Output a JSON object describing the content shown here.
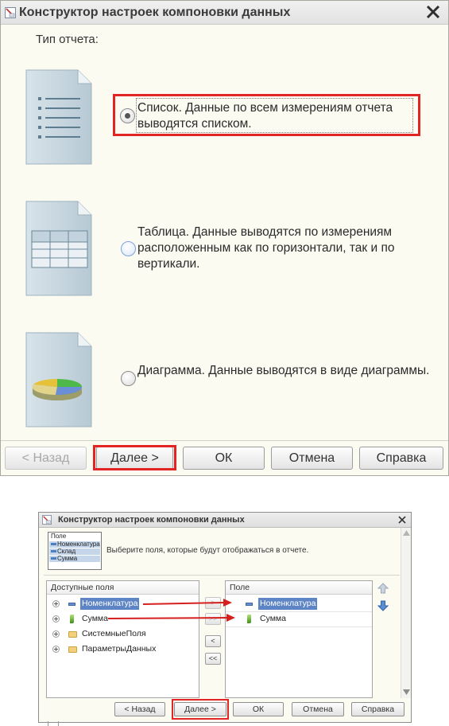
{
  "dialog1": {
    "title": "Конструктор настроек компоновки данных",
    "section_label": "Тип отчета:",
    "options": [
      {
        "label": "Список. Данные по всем измерениям отчета выводятся списком.",
        "selected": true
      },
      {
        "label": "Таблица. Данные выводятся по измерениям расположенным как по горизонтали, так и по вертикали.",
        "selected": false
      },
      {
        "label": "Диаграмма. Данные выводятся в виде диаграммы.",
        "selected": false
      }
    ],
    "buttons": {
      "back": "< Назад",
      "next": "Далее >",
      "ok": "ОК",
      "cancel": "Отмена",
      "help": "Справка"
    }
  },
  "dialog2": {
    "title": "Конструктор настроек компоновки данных",
    "thumbnail": {
      "header": "Поле",
      "rows": [
        "Номенклатура",
        "Склад",
        "Сумма"
      ]
    },
    "hint": "Выберите поля, которые будут отображаться в отчете.",
    "available": {
      "header": "Доступные поля",
      "items": [
        "Номенклатура",
        "Сумма",
        "СистемныеПоля",
        "ПараметрыДанных"
      ]
    },
    "move_buttons": {
      "add": ">",
      "add_all": ">>",
      "remove": "<",
      "remove_all": "<<"
    },
    "selected": {
      "header": "Поле",
      "items": [
        "Номенклатура",
        "Сумма"
      ]
    },
    "buttons": {
      "back": "< Назад",
      "next": "Далее >",
      "ok": "ОК",
      "cancel": "Отмена",
      "help": "Справка"
    }
  },
  "colors": {
    "highlight": "#e32424",
    "selection": "#5d84c4",
    "dialog_bg": "#fbfbf1"
  }
}
